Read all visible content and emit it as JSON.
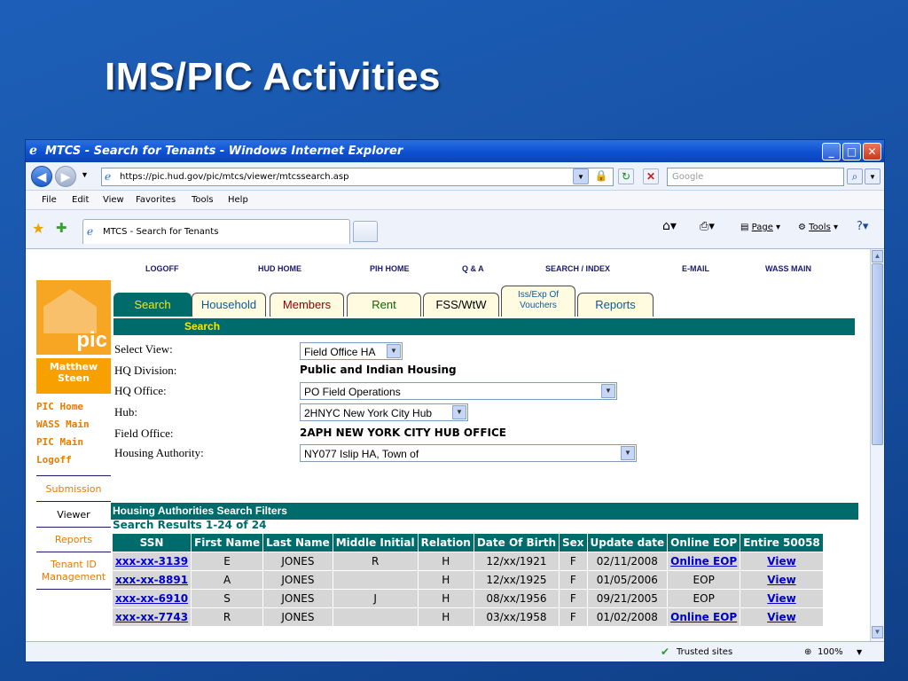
{
  "slide": {
    "title": "IMS/PIC Activities"
  },
  "window": {
    "title": "MTCS - Search for Tenants - Windows Internet Explorer"
  },
  "address": {
    "url": "https://pic.hud.gov/pic/mtcs/viewer/mtcssearch.asp",
    "search_placeholder": "Google"
  },
  "menu": [
    "File",
    "Edit",
    "View",
    "Favorites",
    "Tools",
    "Help"
  ],
  "browser_tab": {
    "label": "MTCS - Search for Tenants"
  },
  "toolbar": {
    "page": "Page",
    "tools": "Tools"
  },
  "status": {
    "zone": "Trusted sites",
    "zoom": "100%"
  },
  "topnav": [
    "LOGOFF",
    "HUD HOME",
    "PIH HOME",
    "Q & A",
    "SEARCH / INDEX",
    "E-MAIL",
    "WASS MAIN"
  ],
  "logo": {
    "text": "pic"
  },
  "user": {
    "name": "Matthew Steen"
  },
  "sidelinks": [
    "PIC Home",
    "WASS Main",
    "PIC Main",
    "Logoff"
  ],
  "sidenav": [
    "Submission",
    "Viewer",
    "Reports",
    "Tenant ID Management"
  ],
  "tabs": [
    "Search",
    "Household",
    "Members",
    "Rent",
    "FSS/WtW",
    "Iss/Exp Of Vouchers",
    "Reports"
  ],
  "section_title": "Search",
  "form": {
    "select_view": {
      "label": "Select View:",
      "value": "Field Office HA"
    },
    "hq_division": {
      "label": "HQ Division:",
      "value": "Public and Indian Housing"
    },
    "hq_office": {
      "label": "HQ Office:",
      "value": "PO Field Operations"
    },
    "hub": {
      "label": "Hub:",
      "value": "2HNYC New York City Hub"
    },
    "field_office": {
      "label": "Field Office:",
      "value": "2APH NEW YORK CITY HUB OFFICE"
    },
    "housing_authority": {
      "label": "Housing Authority:",
      "value": "NY077 Islip HA, Town of"
    }
  },
  "filters_title": "Housing Authorities Search Filters",
  "results_label": "Search Results 1-24 of 24",
  "table": {
    "headers": [
      "SSN",
      "First Name",
      "Last Name",
      "Middle Initial",
      "Relation",
      "Date Of Birth",
      "Sex",
      "Update date",
      "Online EOP",
      "Entire 50058"
    ],
    "rows": [
      [
        "xxx-xx-3139",
        "E",
        "JONES",
        "R",
        "H",
        "12/xx/1921",
        "F",
        "02/11/2008",
        "Online EOP",
        "View"
      ],
      [
        "xxx-xx-8891",
        "A",
        "JONES",
        "",
        "H",
        "12/xx/1925",
        "F",
        "01/05/2006",
        "EOP",
        "View"
      ],
      [
        "xxx-xx-6910",
        "S",
        "JONES",
        "J",
        "H",
        "08/xx/1956",
        "F",
        "09/21/2005",
        "EOP",
        "View"
      ],
      [
        "xxx-xx-7743",
        "R",
        "JONES",
        "",
        "H",
        "03/xx/1958",
        "F",
        "01/02/2008",
        "Online EOP",
        "View"
      ]
    ]
  }
}
